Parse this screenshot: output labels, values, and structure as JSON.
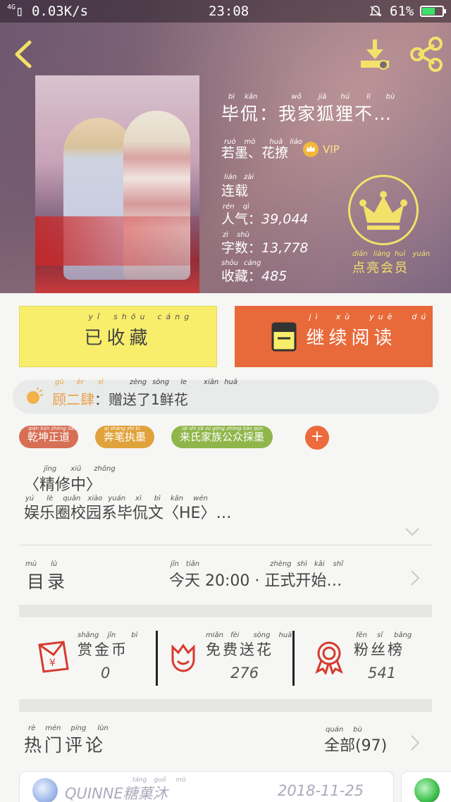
{
  "status_bar": {
    "network": "4G",
    "speed": "0.03K/s",
    "time": "23:08",
    "battery": "61%"
  },
  "book": {
    "title": "毕侃：我家狐狸不…",
    "title_pinyin": [
      "bì",
      "kǎn",
      "wǒ",
      "jiā",
      "hú",
      "lí",
      "bù"
    ],
    "author": "若墨、花撩",
    "author_pinyin": [
      "ruò",
      "mò",
      "huā",
      "liáo"
    ],
    "vip_label": "VIP",
    "status": "连载",
    "status_pinyin": [
      "lián",
      "zài"
    ],
    "popularity_label": "人气：",
    "popularity_pinyin": [
      "rén",
      "qì"
    ],
    "popularity": "39,044",
    "word_count_label": "字数：",
    "word_count_pinyin": [
      "zì",
      "shù"
    ],
    "word_count": "13,778",
    "favorites_label": "收藏：",
    "favorites_pinyin": [
      "shōu",
      "cáng"
    ],
    "favorites": "485"
  },
  "member": {
    "label": "点亮会员",
    "pinyin": [
      "diǎn",
      "liàng",
      "huì",
      "yuán"
    ]
  },
  "actions": {
    "collected_label": "已收藏",
    "collected_pinyin": [
      "yǐ",
      "shōu",
      "cáng"
    ],
    "read_label": "继续阅读",
    "read_pinyin": [
      "jì",
      "xù",
      "yuè",
      "dú"
    ]
  },
  "gift": {
    "name": "顾二肆",
    "name_pinyin": [
      "gù",
      "èr",
      "sì"
    ],
    "message": "：赠送了1鲜花",
    "message_pinyin": [
      "zèng",
      "sòng",
      "le",
      "xiān",
      "huā"
    ]
  },
  "tags": [
    {
      "label": "乾坤正道",
      "pinyin": "qián kūn zhèng dào",
      "color": "#d76f55"
    },
    {
      "label": "奔笔执墨",
      "pinyin": "qí shàng zhí bǐ",
      "color": "#e0a23a"
    },
    {
      "label": "来氏家族公众採墨",
      "pinyin": "lái shì jiā zú gōng zhòng bāo qún",
      "color": "#8fb64a"
    }
  ],
  "tag_more": "+",
  "description": {
    "line1": "〈精修中〉",
    "line1_pinyin": [
      "jīng",
      "xiū",
      "zhōng"
    ],
    "line2": "娱乐圈校园系毕侃文〈HE〉…",
    "line2_pinyin": [
      "yú",
      "lè",
      "quān",
      "xiào",
      "yuán",
      "xì",
      "bì",
      "kǎn",
      "wén"
    ]
  },
  "toc": {
    "label": "目录",
    "label_pinyin": [
      "mù",
      "lù"
    ],
    "value": "今天 20:00 · 正式开始…",
    "value_pinyin": [
      "jīn",
      "tiān",
      "zhèng",
      "shì",
      "kāi",
      "shǐ"
    ]
  },
  "stats": {
    "coins_label": "赏金币",
    "coins_pinyin": [
      "shǎng",
      "jīn",
      "bì"
    ],
    "coins_value": "0",
    "flowers_label": "免费送花",
    "flowers_pinyin": [
      "miǎn",
      "fèi",
      "sòng",
      "huā"
    ],
    "flowers_value": "276",
    "fans_label": "粉丝榜",
    "fans_pinyin": [
      "fěn",
      "sī",
      "bǎng"
    ],
    "fans_value": "541"
  },
  "comments": {
    "label": "热门评论",
    "label_pinyin": [
      "rè",
      "mén",
      "píng",
      "lùn"
    ],
    "all_label": "全部(97)",
    "all_pinyin": [
      "quán",
      "bù"
    ],
    "first_user": "QUINNE糖菓沐",
    "first_user_pinyin": [
      "táng",
      "guǒ",
      "mù"
    ],
    "first_date": "2018-11-25"
  },
  "colors": {
    "accent_yellow": "#f8ee6b",
    "accent_orange": "#e86a3a",
    "crown_yellow": "#f3e26a"
  }
}
